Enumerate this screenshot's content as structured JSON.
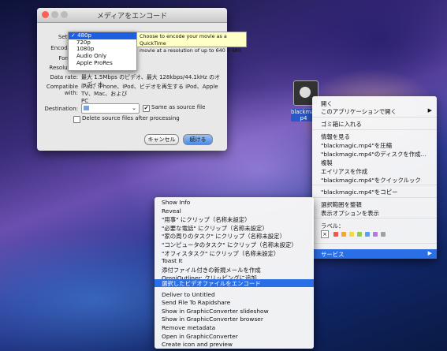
{
  "encode_window": {
    "title": "メディアをエンコード",
    "setting_label": "Setting",
    "encode_for_label": "Encode fo",
    "format_label": "Format",
    "resolution_label": "Resolution",
    "data_rate_label": "Data rate:",
    "data_rate_value": "最大 1.5Mbps のビデオ、最大 128kbps/44.1kHz のオーディオ",
    "compatible_label": "Compatible with:",
    "compatible_value_line1": "iPad、iPhone、iPod、ビデオを再生する iPod、Apple TV、Mac、および",
    "compatible_value_line2": "PC",
    "destination_label": "Destination:",
    "same_as_source_label": "Same as source file",
    "same_as_source_checked": "✔",
    "delete_source_label": "Delete source files after processing",
    "cancel_button": "キャンセル",
    "continue_button": "続ける"
  },
  "setting_popup": {
    "items": [
      "480p",
      "720p",
      "1080p",
      "Audio Only",
      "Apple ProRes"
    ],
    "selected_mark": "✓"
  },
  "tooltip": {
    "line1": "Choose to encode your movie as a QuickTime",
    "line2": "movie at a resolution of up to 640 x 480."
  },
  "file_icon": {
    "label_line1": "blackmag",
    "label_line2": "p4"
  },
  "context_menu": {
    "open": "開く",
    "open_with": "このアプリケーションで開く",
    "trash": "ゴミ箱に入れる",
    "get_info": "情報を見る",
    "compress": "\"blackmagic.mp4\"を圧縮",
    "burn": "\"blackmagic.mp4\"のディスクを作成...",
    "duplicate": "複製",
    "alias": "エイリアスを作成",
    "quicklook": "\"blackmagic.mp4\"をクイックルック",
    "copy": "\"blackmagic.mp4\"をコピー",
    "clean_up": "選択範囲を整頓",
    "view_options": "表示オプションを表示",
    "label_heading": "ラベル：",
    "services": "サービス",
    "label_colors": [
      "#f2574c",
      "#f7a33b",
      "#f5da3b",
      "#8ad04b",
      "#5aa0f0",
      "#b57ad6",
      "#a0a0a0"
    ]
  },
  "services_menu": {
    "items": [
      "Show Info",
      "Reveal",
      "\"用事\" にクリップ（名称未設定）",
      "\"必要な電話\" にクリップ（名称未設定）",
      "\"家の周りのタスク\" にクリップ（名称未設定）",
      "\"コンピュータのタスク\" にクリップ（名称未設定）",
      "\"オフィスタスク\" にクリップ（名称未設定）",
      "Toast It",
      "添付ファイル付きの新規メールを作成",
      "OmniOutliner: クリッピングに追加",
      "選択したビデオファイルをエンコード",
      "Deliver to Untitled",
      "Send File To Rapidshare",
      "Show in GraphicConverter slideshow",
      "Show in GraphicConverter browser",
      "Remove metadata",
      "Open in GraphicConverter",
      "Create icon and preview"
    ]
  }
}
